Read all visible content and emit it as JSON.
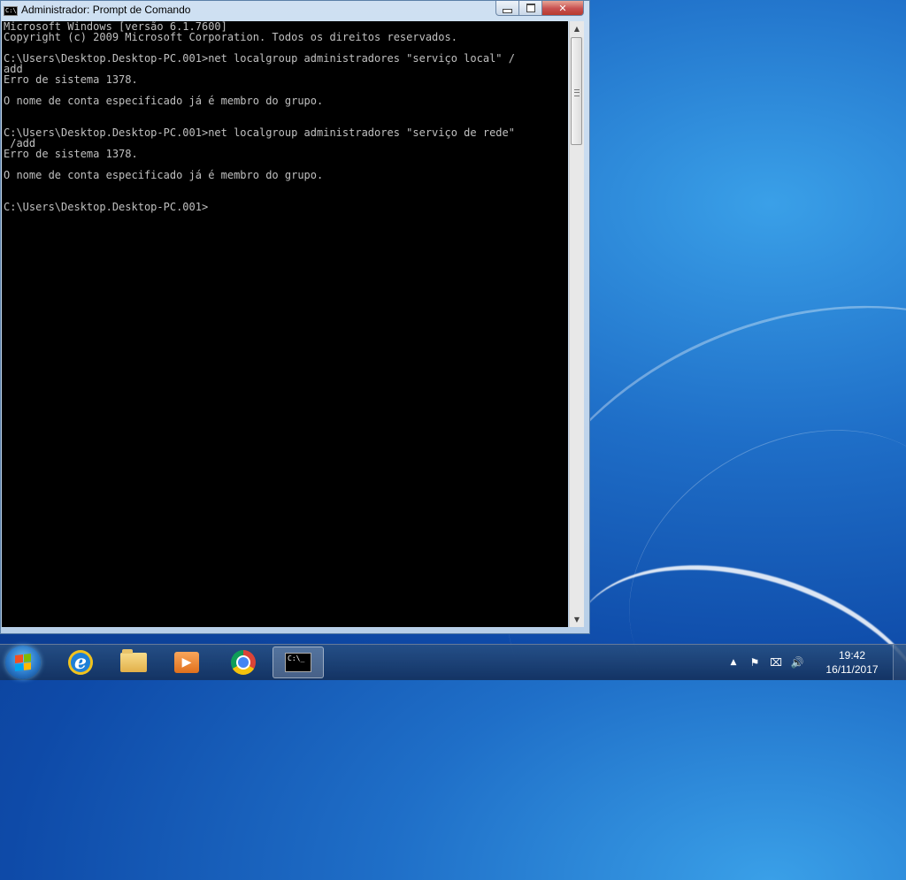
{
  "window": {
    "title": "Administrador: Prompt de Comando",
    "icon": "cmd-icon",
    "buttons": {
      "minimize": "minimize-icon",
      "maximize": "maximize-icon",
      "close": "✕"
    }
  },
  "console": {
    "lines": [
      "Microsoft Windows [versão 6.1.7600]",
      "Copyright (c) 2009 Microsoft Corporation. Todos os direitos reservados.",
      "",
      "C:\\Users\\Desktop.Desktop-PC.001>net localgroup administradores \"serviço local\" /",
      "add",
      "Erro de sistema 1378.",
      "",
      "O nome de conta especificado já é membro do grupo.",
      "",
      "",
      "C:\\Users\\Desktop.Desktop-PC.001>net localgroup administradores \"serviço de rede\"",
      " /add",
      "Erro de sistema 1378.",
      "",
      "O nome de conta especificado já é membro do grupo.",
      "",
      "",
      "C:\\Users\\Desktop.Desktop-PC.001>"
    ]
  },
  "scrollbar": {
    "up": "▲",
    "down": "▼"
  },
  "taskbar": {
    "items": [
      {
        "name": "internet-explorer-icon",
        "glyph": "e"
      },
      {
        "name": "windows-explorer-icon"
      },
      {
        "name": "media-player-icon",
        "glyph": "▶"
      },
      {
        "name": "chrome-icon"
      },
      {
        "name": "command-prompt-icon",
        "glyph": "C:\\_",
        "active": true
      }
    ],
    "tray": {
      "show_hidden": "▲",
      "flag": "⚑",
      "network": "⌧",
      "volume": "🔊"
    },
    "clock": {
      "time": "19:42",
      "date": "16/11/2017"
    }
  },
  "colors": {
    "console_bg": "#000000",
    "console_fg": "#c0c0c0",
    "close_button": "#c75050",
    "desktop_blue": "#1f6fc8"
  }
}
